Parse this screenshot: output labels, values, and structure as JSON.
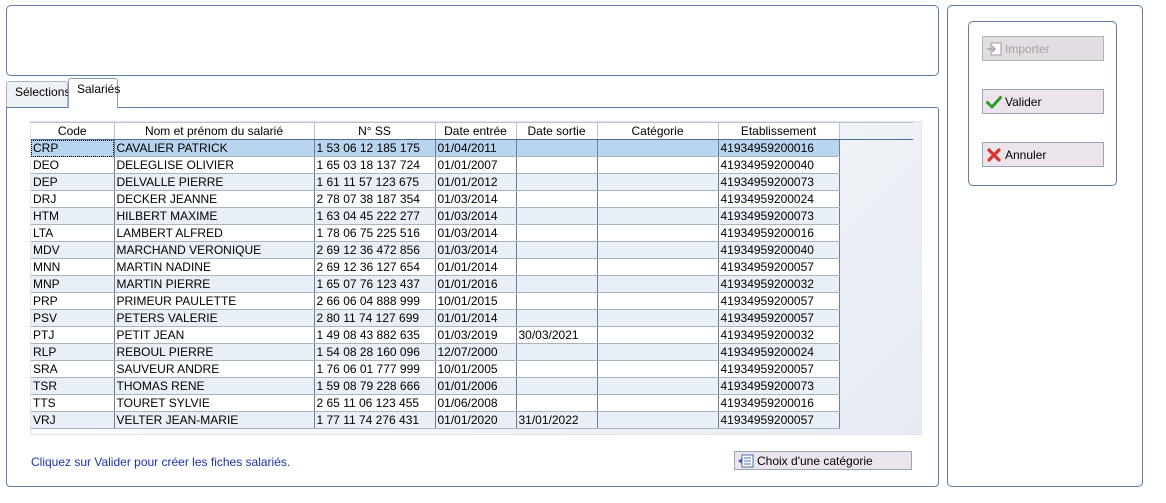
{
  "tabs": [
    {
      "label": "Sélections",
      "active": false
    },
    {
      "label": "Salariés",
      "active": true
    }
  ],
  "grid": {
    "columns": [
      "Code",
      "Nom et prénom du salarié",
      "N° SS",
      "Date entrée",
      "Date sortie",
      "Catégorie",
      "Etablissement"
    ],
    "selected_row": 0,
    "rows": [
      [
        "CRP",
        "CAVALIER PATRICK",
        "1 53 06 12 185 175",
        "01/04/2011",
        "",
        "",
        "41934959200016"
      ],
      [
        "DEO",
        "DELEGLISE OLIVIER",
        "1 65 03 18 137 724",
        "01/01/2007",
        "",
        "",
        "41934959200040"
      ],
      [
        "DEP",
        "DELVALLE PIERRE",
        "1 61 11 57 123 675",
        "01/01/2012",
        "",
        "",
        "41934959200073"
      ],
      [
        "DRJ",
        "DECKER JEANNE",
        "2 78 07 38 187 354",
        "01/03/2014",
        "",
        "",
        "41934959200024"
      ],
      [
        "HTM",
        "HILBERT MAXIME",
        "1 63 04 45 222 277",
        "01/03/2014",
        "",
        "",
        "41934959200073"
      ],
      [
        "LTA",
        "LAMBERT ALFRED",
        "1 78 06 75 225 516",
        "01/03/2014",
        "",
        "",
        "41934959200016"
      ],
      [
        "MDV",
        "MARCHAND VERONIQUE",
        "2 69 12 36 472 856",
        "01/03/2014",
        "",
        "",
        "41934959200040"
      ],
      [
        "MNN",
        "MARTIN NADINE",
        "2 69 12 36 127 654",
        "01/01/2014",
        "",
        "",
        "41934959200057"
      ],
      [
        "MNP",
        "MARTIN PIERRE",
        "1 65 07 76 123 437",
        "01/01/2016",
        "",
        "",
        "41934959200032"
      ],
      [
        "PRP",
        "PRIMEUR PAULETTE",
        "2 66 06 04 888 999",
        "10/01/2015",
        "",
        "",
        "41934959200057"
      ],
      [
        "PSV",
        "PETERS VALERIE",
        "2 80 11 74 127 699",
        "01/01/2014",
        "",
        "",
        "41934959200057"
      ],
      [
        "PTJ",
        "PETIT JEAN",
        "1 49 08 43 882 635",
        "01/03/2019",
        "30/03/2021",
        "",
        "41934959200032"
      ],
      [
        "RLP",
        "REBOUL PIERRE",
        "1 54 08 28 160 096",
        "12/07/2000",
        "",
        "",
        "41934959200024"
      ],
      [
        "SRA",
        "SAUVEUR ANDRE",
        "1 76 06 01 777 999",
        "10/01/2005",
        "",
        "",
        "41934959200057"
      ],
      [
        "TSR",
        "THOMAS RENE",
        "1 59 08 79 228 666",
        "01/01/2006",
        "",
        "",
        "41934959200073"
      ],
      [
        "TTS",
        "TOURET SYLVIE",
        "2 65 11 06 123 455",
        "01/06/2008",
        "",
        "",
        "41934959200016"
      ],
      [
        "VRJ",
        "VELTER JEAN-MARIE",
        "1 77 11 74 276 431",
        "01/01/2020",
        "31/01/2022",
        "",
        "41934959200057"
      ]
    ]
  },
  "hint": "Cliquez sur Valider pour créer les fiches salariés.",
  "buttons": {
    "choix_categorie": {
      "label": "Choix d'une catégorie",
      "icon": "list-icon"
    },
    "importer": {
      "label": "Importer",
      "icon": "import-icon",
      "enabled": false
    },
    "valider": {
      "label": "Valider",
      "icon": "check-icon"
    },
    "annuler": {
      "label": "Annuler",
      "icon": "cross-icon"
    }
  },
  "colors": {
    "border": "#5a7ea8",
    "selected_row": "#b8d4ef",
    "alt_row": "#e9eff6",
    "hint_text": "#1a33b3",
    "button_bg": "#ece4ec"
  }
}
